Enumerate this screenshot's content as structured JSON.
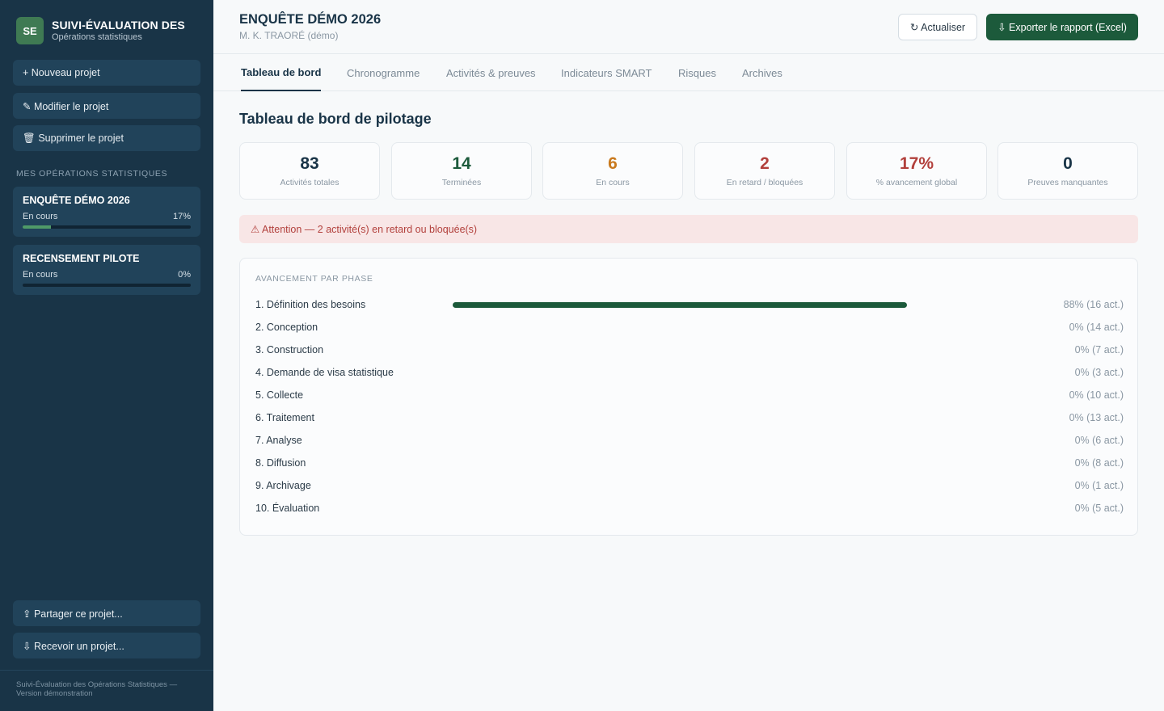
{
  "brand": {
    "logo": "SE",
    "title": "SUIVI-ÉVALUATION DES",
    "subtitle": "Opérations statistiques"
  },
  "sidebar": {
    "actions": [
      {
        "label": "+ Nouveau projet"
      },
      {
        "label": "✎ Modifier le projet"
      },
      {
        "label": "🗑 Supprimer le projet"
      }
    ],
    "section_label": "MES OPÉRATIONS STATISTIQUES",
    "projects": [
      {
        "name": "ENQUÊTE DÉMO 2026",
        "status": "En cours",
        "progress_label": "17%",
        "progress": 17
      },
      {
        "name": "RECENSEMENT PILOTE",
        "status": "En cours",
        "progress_label": "0%",
        "progress": 0
      }
    ],
    "bottom_actions": [
      {
        "label": "⇪ Partager ce projet..."
      },
      {
        "label": "⇩ Recevoir un projet..."
      }
    ],
    "footer": "Suivi-Évaluation des Opérations Statistiques — Version démonstration"
  },
  "header": {
    "project_title": "ENQUÊTE DÉMO 2026",
    "owner": "M. K. TRAORÉ (démo)",
    "refresh_label": "↻ Actualiser",
    "export_label": "⇩ Exporter le rapport (Excel)"
  },
  "tabs": [
    {
      "label": "Tableau de bord",
      "active": true
    },
    {
      "label": "Chronogramme"
    },
    {
      "label": "Activités & preuves"
    },
    {
      "label": "Indicateurs SMART"
    },
    {
      "label": "Risques"
    },
    {
      "label": "Archives"
    }
  ],
  "dashboard": {
    "title": "Tableau de bord de pilotage",
    "stats": [
      {
        "value": "83",
        "label": "Activités totales",
        "color": "#193447"
      },
      {
        "value": "14",
        "label": "Terminées",
        "color": "#1c5a3b"
      },
      {
        "value": "6",
        "label": "En cours",
        "color": "#c97a1e"
      },
      {
        "value": "2",
        "label": "En retard / bloquées",
        "color": "#b2403c"
      },
      {
        "value": "17%",
        "label": "% avancement global",
        "color": "#b2403c"
      },
      {
        "value": "0",
        "label": "Preuves manquantes",
        "color": "#193447"
      }
    ],
    "alert": "⚠ Attention — 2 activité(s) en retard ou bloquée(s)",
    "phases_heading": "AVANCEMENT PAR PHASE",
    "phases": [
      {
        "name": "1. Définition des besoins",
        "percent": 88,
        "label": "88% (16 act.)"
      },
      {
        "name": "2. Conception",
        "percent": 0,
        "label": "0% (14 act.)"
      },
      {
        "name": "3. Construction",
        "percent": 0,
        "label": "0% (7 act.)"
      },
      {
        "name": "4. Demande de visa statistique",
        "percent": 0,
        "label": "0% (3 act.)"
      },
      {
        "name": "5. Collecte",
        "percent": 0,
        "label": "0% (10 act.)"
      },
      {
        "name": "6. Traitement",
        "percent": 0,
        "label": "0% (13 act.)"
      },
      {
        "name": "7. Analyse",
        "percent": 0,
        "label": "0% (6 act.)"
      },
      {
        "name": "8. Diffusion",
        "percent": 0,
        "label": "0% (8 act.)"
      },
      {
        "name": "9. Archivage",
        "percent": 0,
        "label": "0% (1 act.)"
      },
      {
        "name": "10. Évaluation",
        "percent": 0,
        "label": "0% (5 act.)"
      }
    ]
  }
}
